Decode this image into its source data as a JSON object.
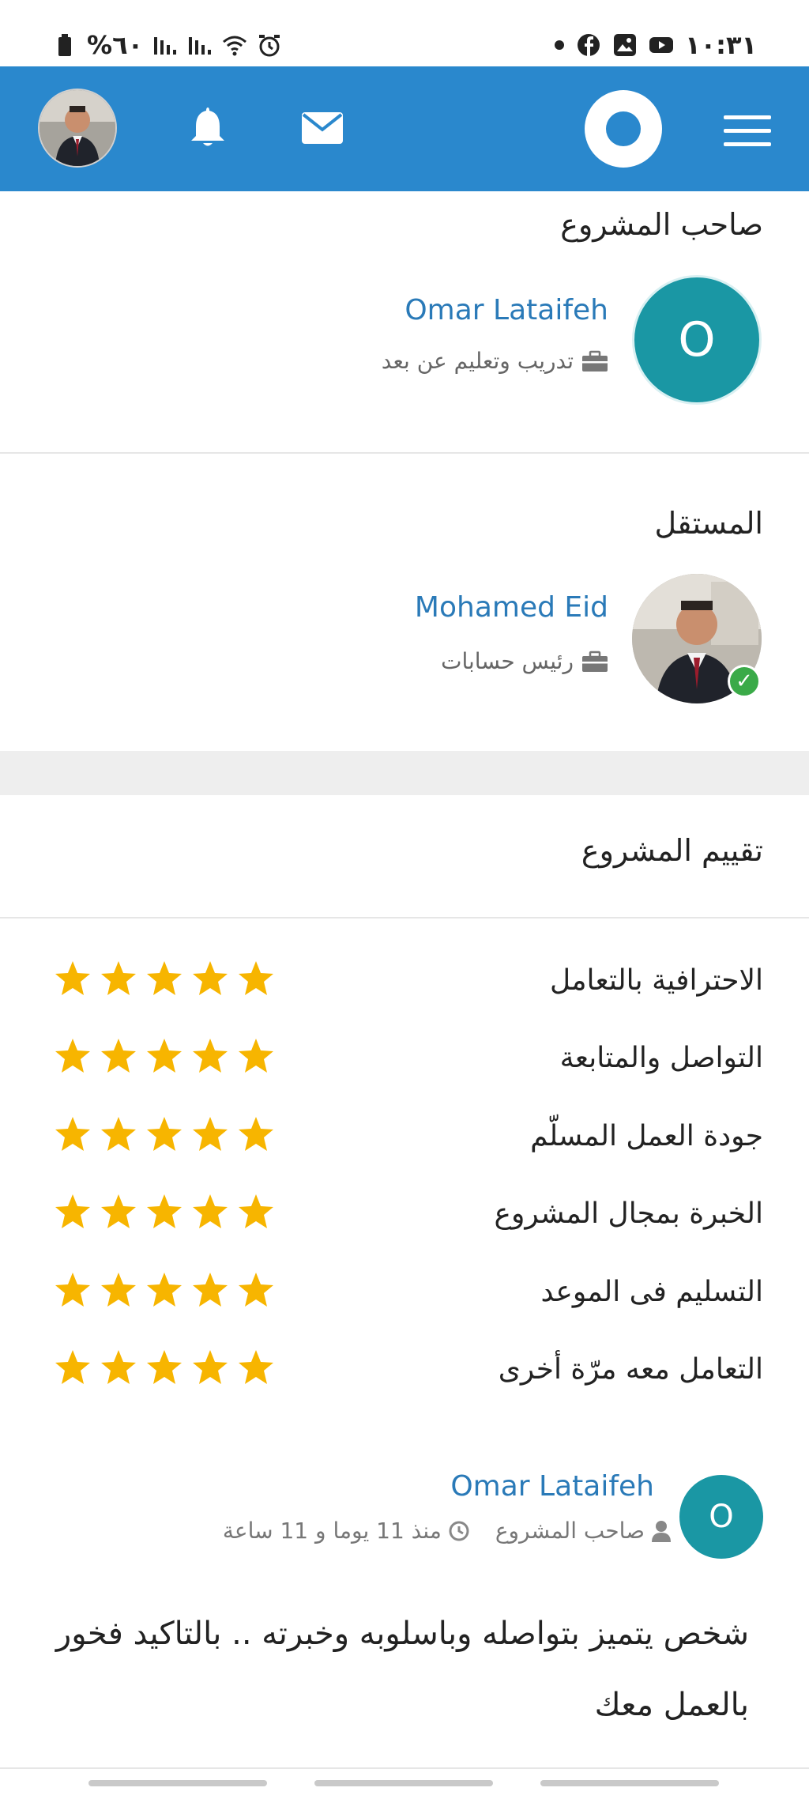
{
  "status_bar": {
    "time": "١٠:٣١",
    "battery": "%٦٠",
    "icons": [
      "battery-icon",
      "signal-icon",
      "signal-icon",
      "wifi-icon",
      "alarm-icon",
      "dot-icon",
      "facebook-icon",
      "gallery-icon",
      "youtube-icon"
    ]
  },
  "header": {
    "bg_color": "#2a88cd",
    "icons": [
      "profile-avatar",
      "bell-icon",
      "mail-icon",
      "logo",
      "menu-icon"
    ]
  },
  "owner_section": {
    "title": "صاحب المشروع",
    "avatar_letter": "O",
    "name": "Omar Lataifeh",
    "role": "تدريب وتعليم عن بعد"
  },
  "freelancer_section": {
    "title": "المستقل",
    "name": "Mohamed Eid",
    "role": "رئيس حسابات"
  },
  "rating_section": {
    "title": "تقييم المشروع",
    "items": [
      {
        "label": "الاحترافية بالتعامل",
        "stars": 5
      },
      {
        "label": "التواصل والمتابعة",
        "stars": 5
      },
      {
        "label": "جودة العمل المسلّم",
        "stars": 5
      },
      {
        "label": "الخبرة بمجال المشروع",
        "stars": 5
      },
      {
        "label": "التسليم فى الموعد",
        "stars": 5
      },
      {
        "label": "التعامل معه مرّة أخرى",
        "stars": 5
      }
    ],
    "star_color": "#f7b500"
  },
  "review": {
    "avatar_letter": "O",
    "name": "Omar Lataifeh",
    "role": "صاحب المشروع",
    "time": "منذ 11 يوما و 11 ساعة",
    "text": "شخص يتميز بتواصله وباسلوبه وخبرته .. بالتاكيد فخور بالعمل معك"
  }
}
